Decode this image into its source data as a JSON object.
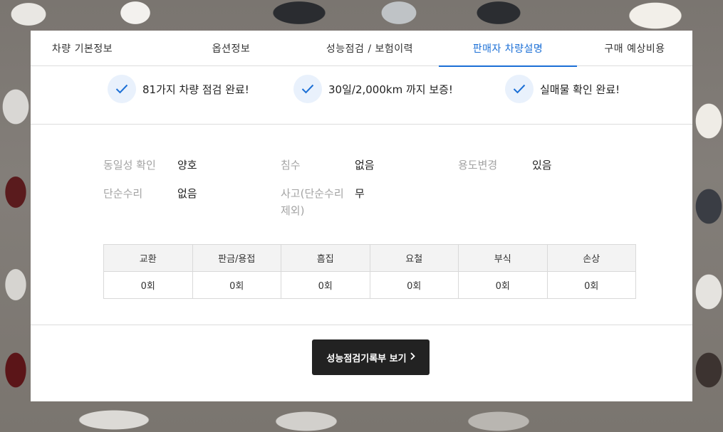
{
  "tabs": [
    {
      "label": "차량 기본정보",
      "active": false
    },
    {
      "label": "옵션정보",
      "active": false
    },
    {
      "label": "성능점검 / 보험이력",
      "active": false
    },
    {
      "label": "판매자 차량설명",
      "active": true
    },
    {
      "label": "구매 예상비용",
      "active": false
    }
  ],
  "guarantees": [
    {
      "icon": "check-icon",
      "text": "81가지 차량 점검 완료!"
    },
    {
      "icon": "check-icon",
      "text": "30일/2,000km 까지 보증!"
    },
    {
      "icon": "check-icon",
      "text": "실매물 확인 완료!"
    }
  ],
  "info": {
    "identity": {
      "label": "동일성 확인",
      "value": "양호"
    },
    "flood": {
      "label": "침수",
      "value": "없음"
    },
    "usage_change": {
      "label": "용도변경",
      "value": "있음"
    },
    "simple_repair": {
      "label": "단순수리",
      "value": "없음"
    },
    "accident": {
      "label_line1": "사고(단순수리",
      "label_line2": "제외)",
      "value": "무"
    }
  },
  "repair_table": {
    "headers": [
      "교환",
      "판금/용접",
      "흠집",
      "요철",
      "부식",
      "손상"
    ],
    "values": [
      "0회",
      "0회",
      "0회",
      "0회",
      "0회",
      "0회"
    ]
  },
  "report_button": {
    "label": "성능점검기록부 보기",
    "icon": "chevron-right-icon"
  },
  "colors": {
    "accent": "#1b6fd6",
    "button": "#222222",
    "check_bg": "#e9f1fc"
  }
}
